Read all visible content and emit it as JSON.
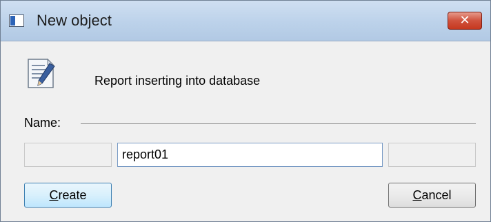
{
  "window": {
    "title": "New object",
    "close_glyph": "✕"
  },
  "message": "Report inserting into database",
  "name_label": "Name:",
  "name_input": {
    "value": "report01"
  },
  "buttons": {
    "create_mnemonic": "C",
    "create_rest": "reate",
    "cancel_mnemonic": "C",
    "cancel_rest": "ancel"
  },
  "icons": {
    "app": "application-window-icon",
    "close": "close-icon",
    "document": "document-edit-icon"
  }
}
